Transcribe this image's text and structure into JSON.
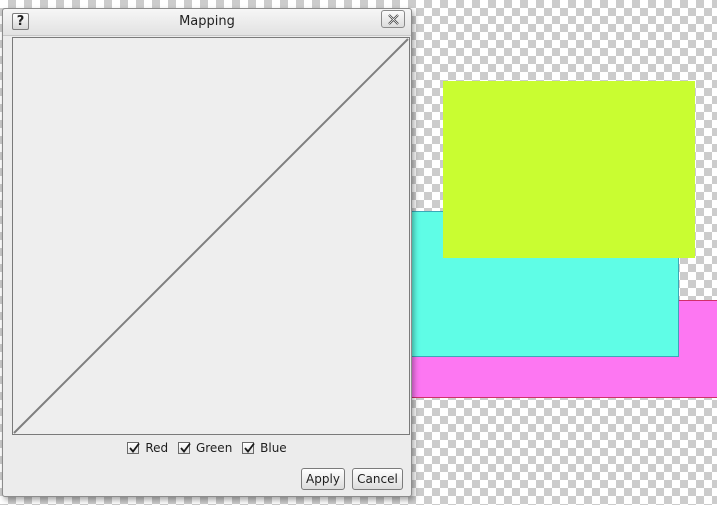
{
  "canvas": {
    "colors": {
      "magenta": "#fd77f2",
      "cyan": "#5ffde6",
      "lime": "#c9fd31"
    }
  },
  "dialog": {
    "title": "Mapping",
    "help_label": "?",
    "close_icon": "close-icon",
    "channels": [
      {
        "label": "Red",
        "checked": true
      },
      {
        "label": "Green",
        "checked": true
      },
      {
        "label": "Blue",
        "checked": true
      }
    ],
    "apply_label": "Apply",
    "cancel_label": "Cancel"
  }
}
